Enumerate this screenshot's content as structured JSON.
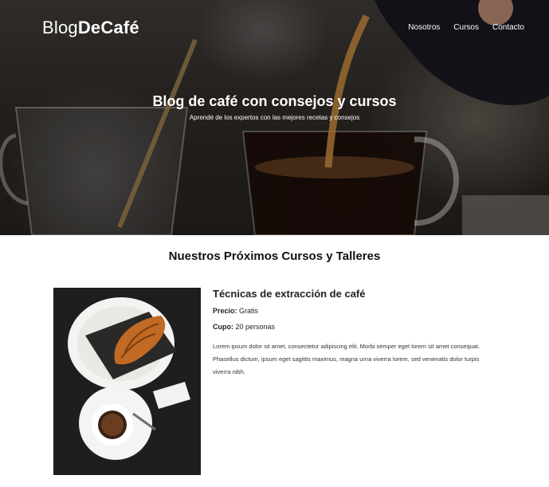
{
  "header": {
    "brand_light": "Blog",
    "brand_bold": "DeCafé",
    "nav": [
      {
        "label": "Nosotros"
      },
      {
        "label": "Cursos"
      },
      {
        "label": "Contacto"
      }
    ]
  },
  "hero": {
    "title": "Blog de café con consejos y cursos",
    "subtitle": "Aprendé de los expertos con las mejores recetas y consejos"
  },
  "main": {
    "section_title": "Nuestros Próximos Cursos y Talleres",
    "courses": [
      {
        "title": "Técnicas de extracción de café",
        "price_label": "Precio:",
        "price_value": "Gratis",
        "capacity_label": "Cupo:",
        "capacity_value": "20 personas",
        "description": "Lorem ipsum dolor sit amet, consectetur adipiscing elit. Morbi semper eget lorem sit amet consequat. Phasellus dictum, ipsum eget sagittis maximus, magna urna viverra lorem, sed venenatis dolor turpis viverra nibh."
      }
    ]
  },
  "colors": {
    "text": "#111111",
    "background": "#ffffff",
    "hero_dark": "#1a1613"
  }
}
